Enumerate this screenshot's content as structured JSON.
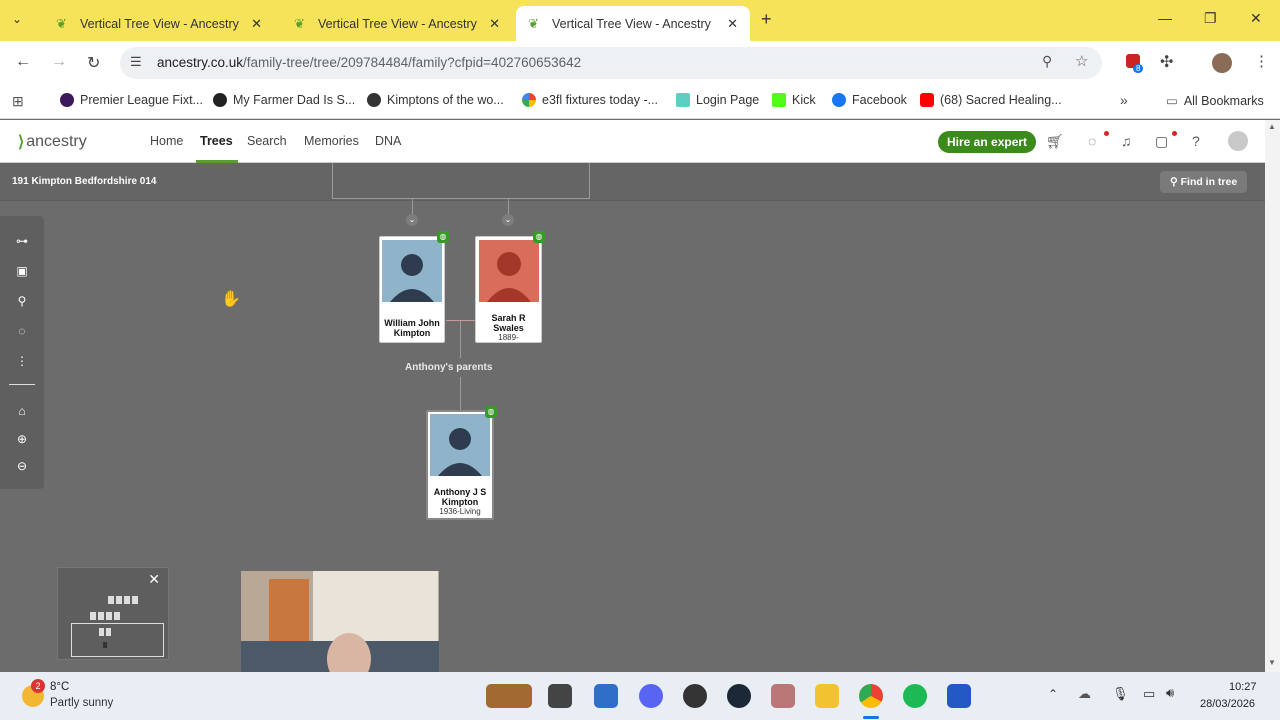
{
  "browser": {
    "tabs": [
      {
        "title": "Vertical Tree View - Ancestry"
      },
      {
        "title": "Vertical Tree View - Ancestry"
      },
      {
        "title": "Vertical Tree View - Ancestry"
      }
    ],
    "url_host": "ancestry.co.uk",
    "url_path": "/family-tree/tree/209784484/family?cfpid=402760653642",
    "extension_badge": "8",
    "bookmarks": [
      "Premier League Fixt...",
      "My Farmer Dad Is S...",
      "Kimptons of the wo...",
      "e3fl fixtures today -...",
      "Login Page",
      "Kick",
      "Facebook",
      "(68) Sacred Healing..."
    ],
    "all_bookmarks": "All Bookmarks"
  },
  "ancestry": {
    "logo": "ancestry",
    "nav": [
      "Home",
      "Trees",
      "Search",
      "Memories",
      "DNA"
    ],
    "hire_expert": "Hire an expert",
    "tree_name": "191 Kimpton Bedfordshire 014",
    "find_in_tree": "Find in tree",
    "parents_label": "Anthony's parents",
    "people": {
      "father": {
        "name_line1": "William John",
        "name_line2": "Kimpton",
        "dates": ""
      },
      "mother": {
        "name_line1": "Sarah R",
        "name_line2": "Swales",
        "dates": "1889-"
      },
      "child": {
        "name_line1": "Anthony J S",
        "name_line2": "Kimpton",
        "dates": "1936-Living"
      }
    }
  },
  "taskbar": {
    "weather_badge": "2",
    "weather_temp": "8°C",
    "weather_desc": "Partly sunny",
    "time": "10:27",
    "date": "28/03/2026"
  },
  "colors": {
    "tab_bar": "#f6e35a",
    "brand_green": "#5a9e2f",
    "hire_button": "#3a8a1c",
    "tree_background": "#6c6c6c",
    "father_avatar": "#8fb3c9",
    "mother_avatar": "#d86e5a"
  }
}
